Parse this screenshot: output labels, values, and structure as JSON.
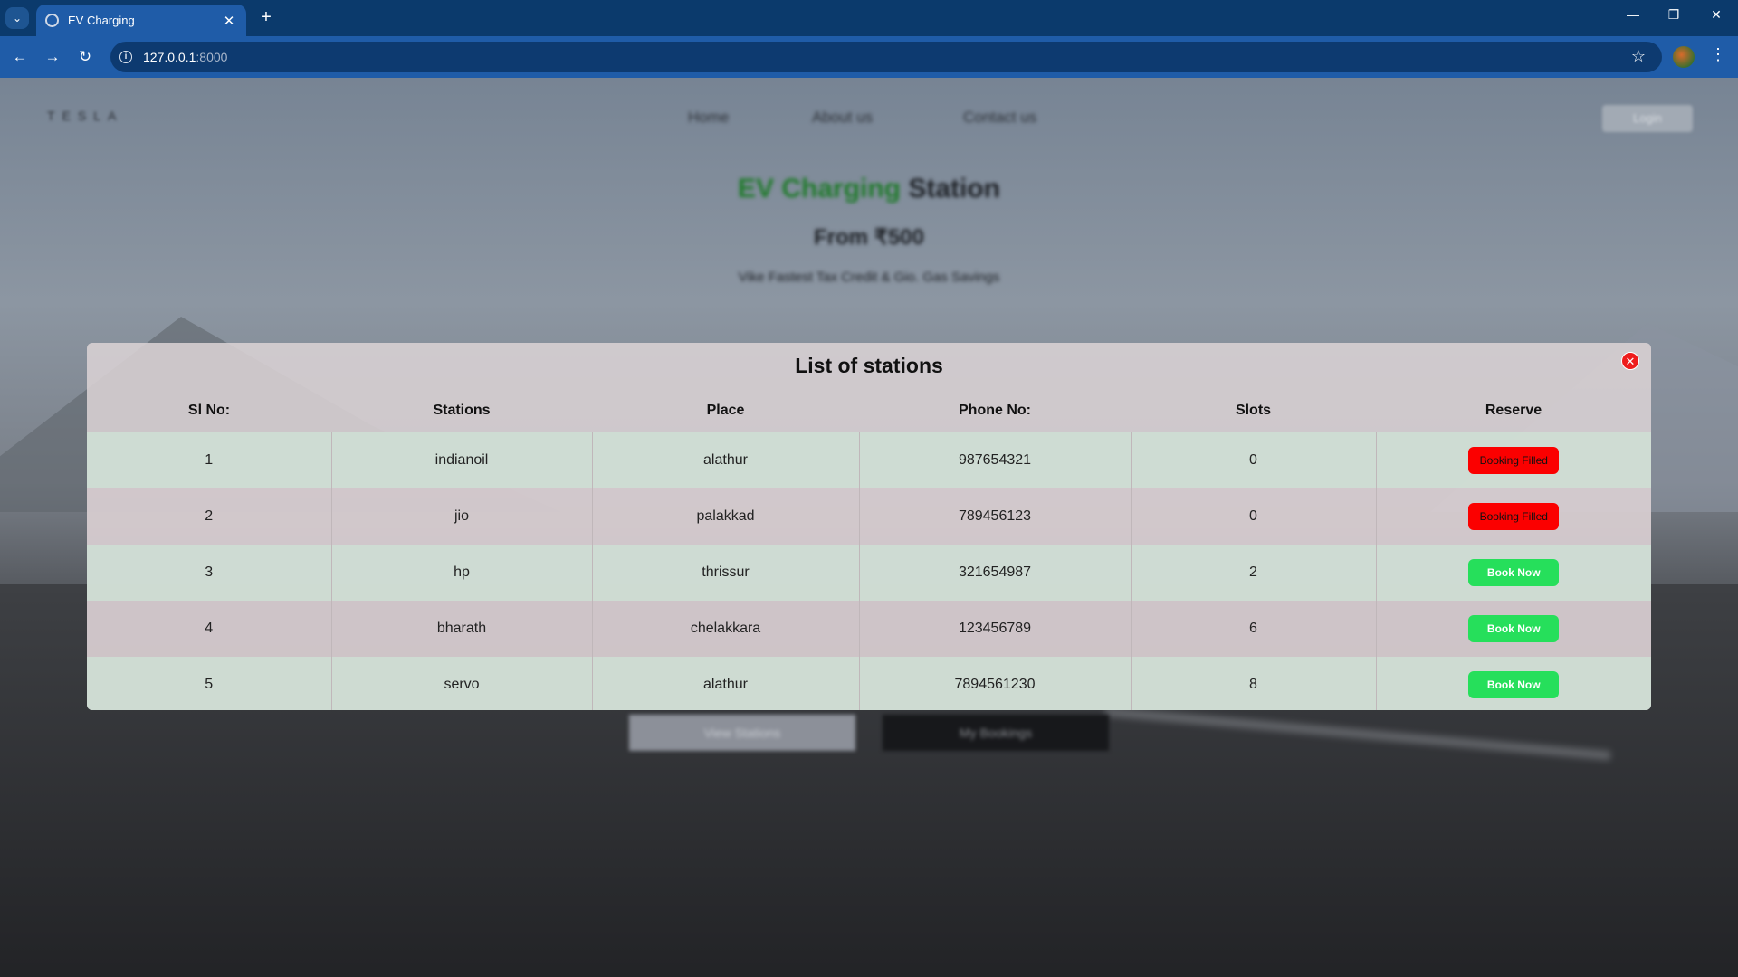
{
  "browser": {
    "tab_title": "EV Charging",
    "url_host": "127.0.0.1",
    "url_port": ":8000"
  },
  "site": {
    "logo": "TESLA",
    "nav": [
      "Home",
      "About us",
      "Contact us"
    ],
    "login": "Login",
    "hero_title_green": "EV Charging",
    "hero_title_rest": " Station",
    "hero_subtitle": "From ₹500",
    "hero_tagline": "Vike Fastest Tax Credit & Gio. Gas Savings",
    "btn_view": "View Stations",
    "btn_bookings": "My Bookings"
  },
  "modal": {
    "title": "List of stations",
    "columns": [
      "Sl No:",
      "Stations",
      "Place",
      "Phone No:",
      "Slots",
      "Reserve"
    ],
    "rows": [
      {
        "sl": "1",
        "station": "indianoil",
        "place": "alathur",
        "phone": "987654321",
        "slots": "0",
        "reserve": "Booking Filled",
        "status": "filled"
      },
      {
        "sl": "2",
        "station": "jio",
        "place": "palakkad",
        "phone": "789456123",
        "slots": "0",
        "reserve": "Booking Filled",
        "status": "filled"
      },
      {
        "sl": "3",
        "station": "hp",
        "place": "thrissur",
        "phone": "321654987",
        "slots": "2",
        "reserve": "Book Now",
        "status": "book"
      },
      {
        "sl": "4",
        "station": "bharath",
        "place": "chelakkara",
        "phone": "123456789",
        "slots": "6",
        "reserve": "Book Now",
        "status": "book"
      },
      {
        "sl": "5",
        "station": "servo",
        "place": "alathur",
        "phone": "7894561230",
        "slots": "8",
        "reserve": "Book Now",
        "status": "book"
      }
    ]
  },
  "colors": {
    "chrome_dark": "#0b3a6c",
    "chrome_light": "#1f5ca8",
    "filled": "#fb0000",
    "book": "#26df5b",
    "close": "#ee1c1c"
  }
}
